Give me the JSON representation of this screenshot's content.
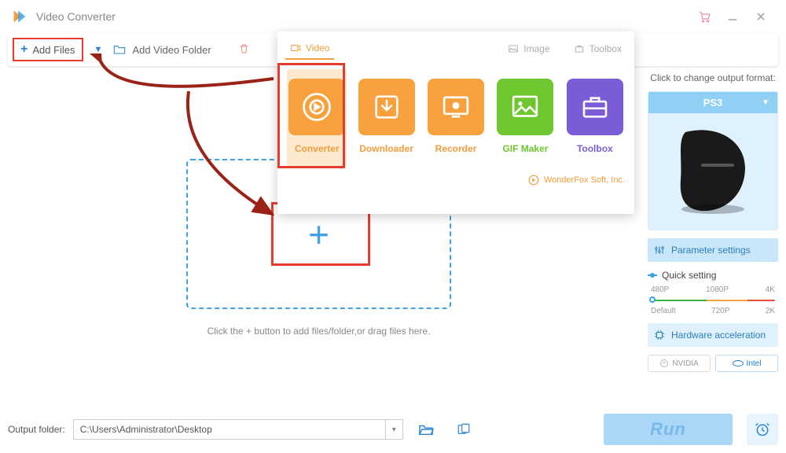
{
  "app": {
    "title": "Video Converter"
  },
  "toolbar": {
    "add_files": "Add Files",
    "add_folder": "Add Video Folder"
  },
  "popup": {
    "tabs": {
      "video": "Video",
      "image": "Image",
      "toolbox": "Toolbox"
    },
    "tiles": {
      "converter": "Converter",
      "downloader": "Downloader",
      "recorder": "Recorder",
      "gifmaker": "GIF Maker",
      "toolbox": "Toolbox"
    },
    "footer": "WonderFox Soft, Inc."
  },
  "drop": {
    "hint": "Click the + button to add files/folder,or drag files here."
  },
  "side": {
    "hdr": "Click to change output format:",
    "format": "PS3",
    "param": "Parameter settings",
    "quick": "Quick setting",
    "q_labels_top": [
      "480P",
      "1080P",
      "4K"
    ],
    "q_labels_bot": [
      "Default",
      "720P",
      "2K"
    ],
    "hw": "Hardware acceleration",
    "chips": {
      "nvidia": "NVIDIA",
      "intel": "Intel"
    }
  },
  "bottom": {
    "label": "Output folder:",
    "path": "C:\\Users\\Administrator\\Desktop",
    "run": "Run"
  }
}
